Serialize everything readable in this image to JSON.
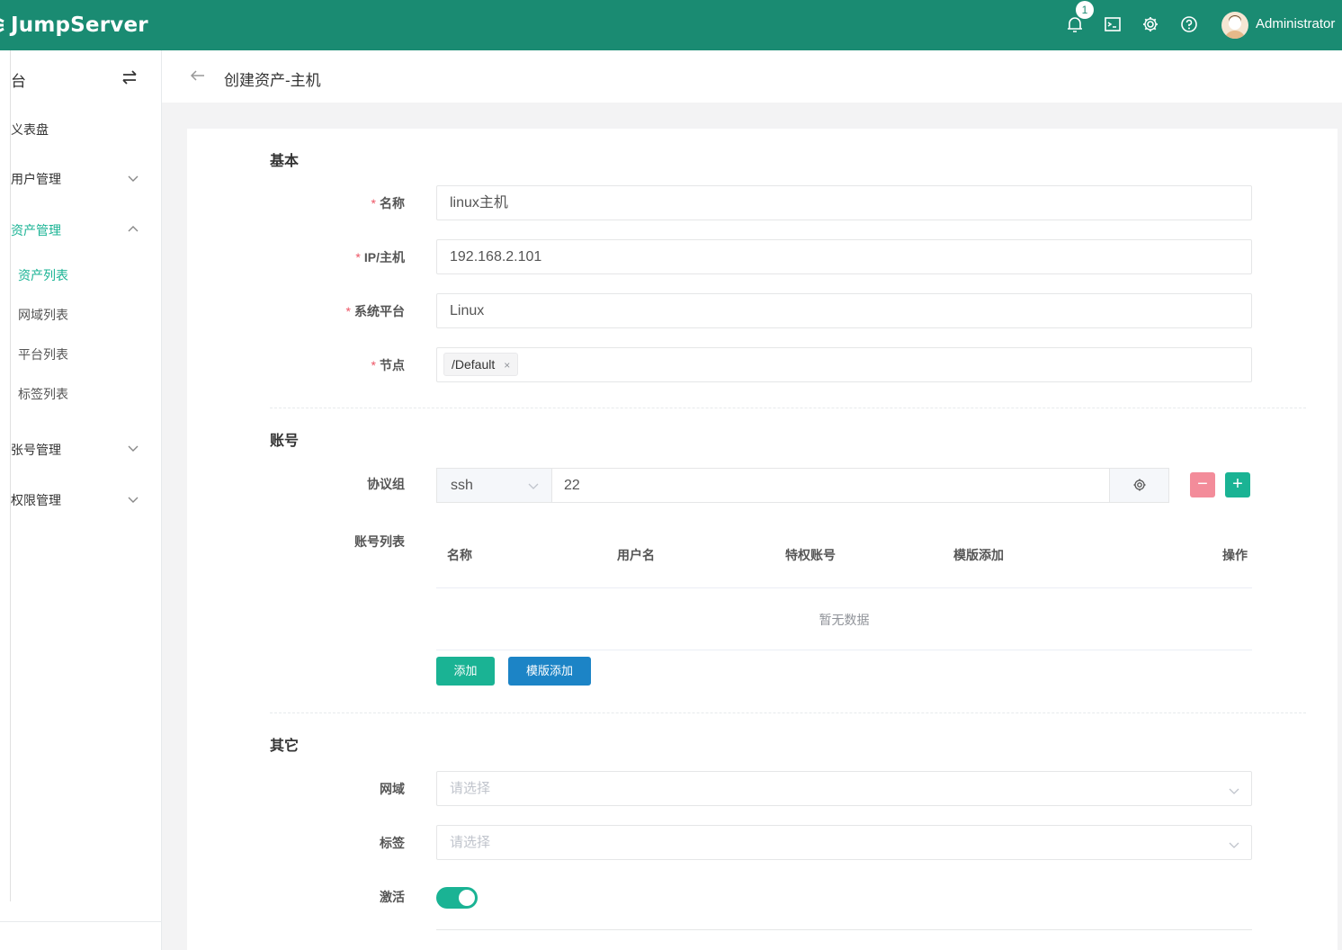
{
  "app": {
    "name": "JumpServer",
    "notification_count": "1",
    "username": "Administrator",
    "icons": [
      "bell-icon",
      "terminal-icon",
      "settings-icon",
      "help-icon",
      "avatar"
    ]
  },
  "colors": {
    "brand": "#1a8b72",
    "accent": "#1ab394",
    "primary": "#1c84c6",
    "danger": "#f38c9a"
  },
  "sidebar": {
    "title": "台",
    "items": [
      {
        "label": "义表盘"
      },
      {
        "label": "用户管理"
      },
      {
        "label": "资产管理"
      },
      {
        "label": "张号管理"
      },
      {
        "label": "权限管理"
      }
    ],
    "subitems": [
      {
        "label": "资产列表"
      },
      {
        "label": "网域列表"
      },
      {
        "label": "平台列表"
      },
      {
        "label": "标签列表"
      }
    ]
  },
  "page": {
    "title": "创建资产-主机"
  },
  "form": {
    "basic": {
      "title": "基本",
      "name_label": "名称",
      "name_value": "linux主机",
      "ip_label": "IP/主机",
      "ip_value": "192.168.2.101",
      "platform_label": "系统平台",
      "platform_value": "Linux",
      "node_label": "节点",
      "node_tag": "/Default",
      "tag_close": "×"
    },
    "account": {
      "title": "账号",
      "protocol_label": "协议组",
      "protocol_value": "ssh",
      "port_value": "22",
      "minus": "−",
      "plus": "+",
      "list_label": "账号列表",
      "columns": [
        "名称",
        "用户名",
        "特权账号",
        "模版添加",
        "操作"
      ],
      "empty_text": "暂无数据",
      "add_button": "添加",
      "template_button": "模版添加"
    },
    "other": {
      "title": "其它",
      "domain_label": "网域",
      "domain_placeholder": "请选择",
      "labels_label": "标签",
      "labels_placeholder": "请选择",
      "active_label": "激活",
      "active": true
    }
  }
}
